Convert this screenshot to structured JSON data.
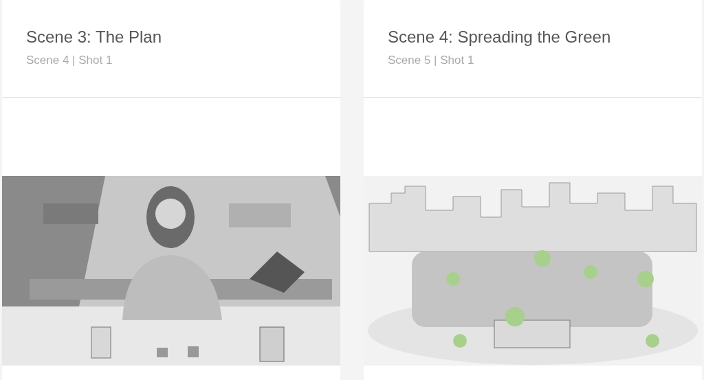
{
  "cards": [
    {
      "title": "Scene 3: The Plan",
      "subtitle": "Scene 4 | Shot 1"
    },
    {
      "title": "Scene 4: Spreading the Green",
      "subtitle": "Scene 5 | Shot 1"
    }
  ]
}
